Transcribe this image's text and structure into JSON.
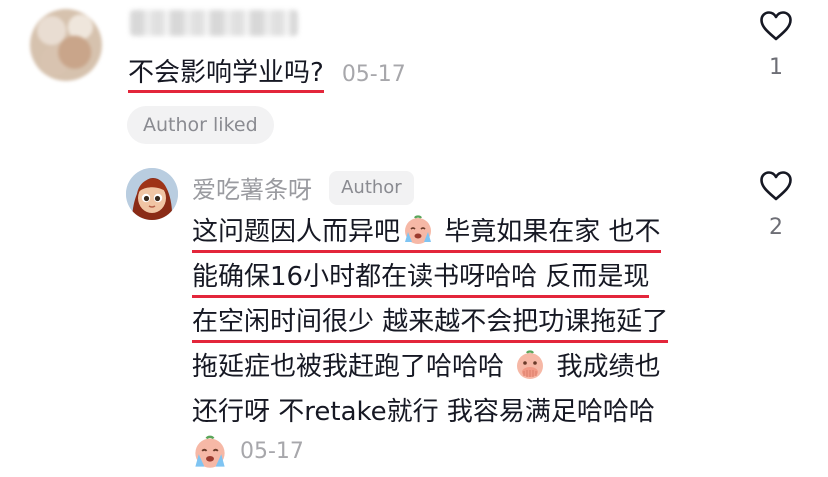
{
  "comment": {
    "text": "不会影响学业吗?",
    "date": "05-17",
    "liked_label": "Author liked",
    "like_count": "1",
    "like_icon": "heart-outline"
  },
  "reply": {
    "username": "爱吃薯条呀",
    "author_tag": "Author",
    "line1_a": "这问题因人而异吧",
    "line1_b": "毕竟如果在家 也不",
    "line2": "能确保16小时都在读书呀哈哈 反而是现",
    "line3": "在空闲时间很少 越来越不会把功课拖延了",
    "line4_a": "拖延症也被我赶跑了哈哈哈 ",
    "line4_b": " 我成绩也",
    "line5": "还行呀 不retake就行 我容易满足哈哈哈",
    "date": "05-17",
    "like_count": "2",
    "like_icon": "heart-outline",
    "emojis": [
      "crying-face-emoji",
      "covering-mouth-face-emoji",
      "crying-face-emoji"
    ]
  },
  "colors": {
    "underline": "#e3263b",
    "muted_text": "#a7a7ab",
    "pill_bg": "#f2f2f3"
  }
}
